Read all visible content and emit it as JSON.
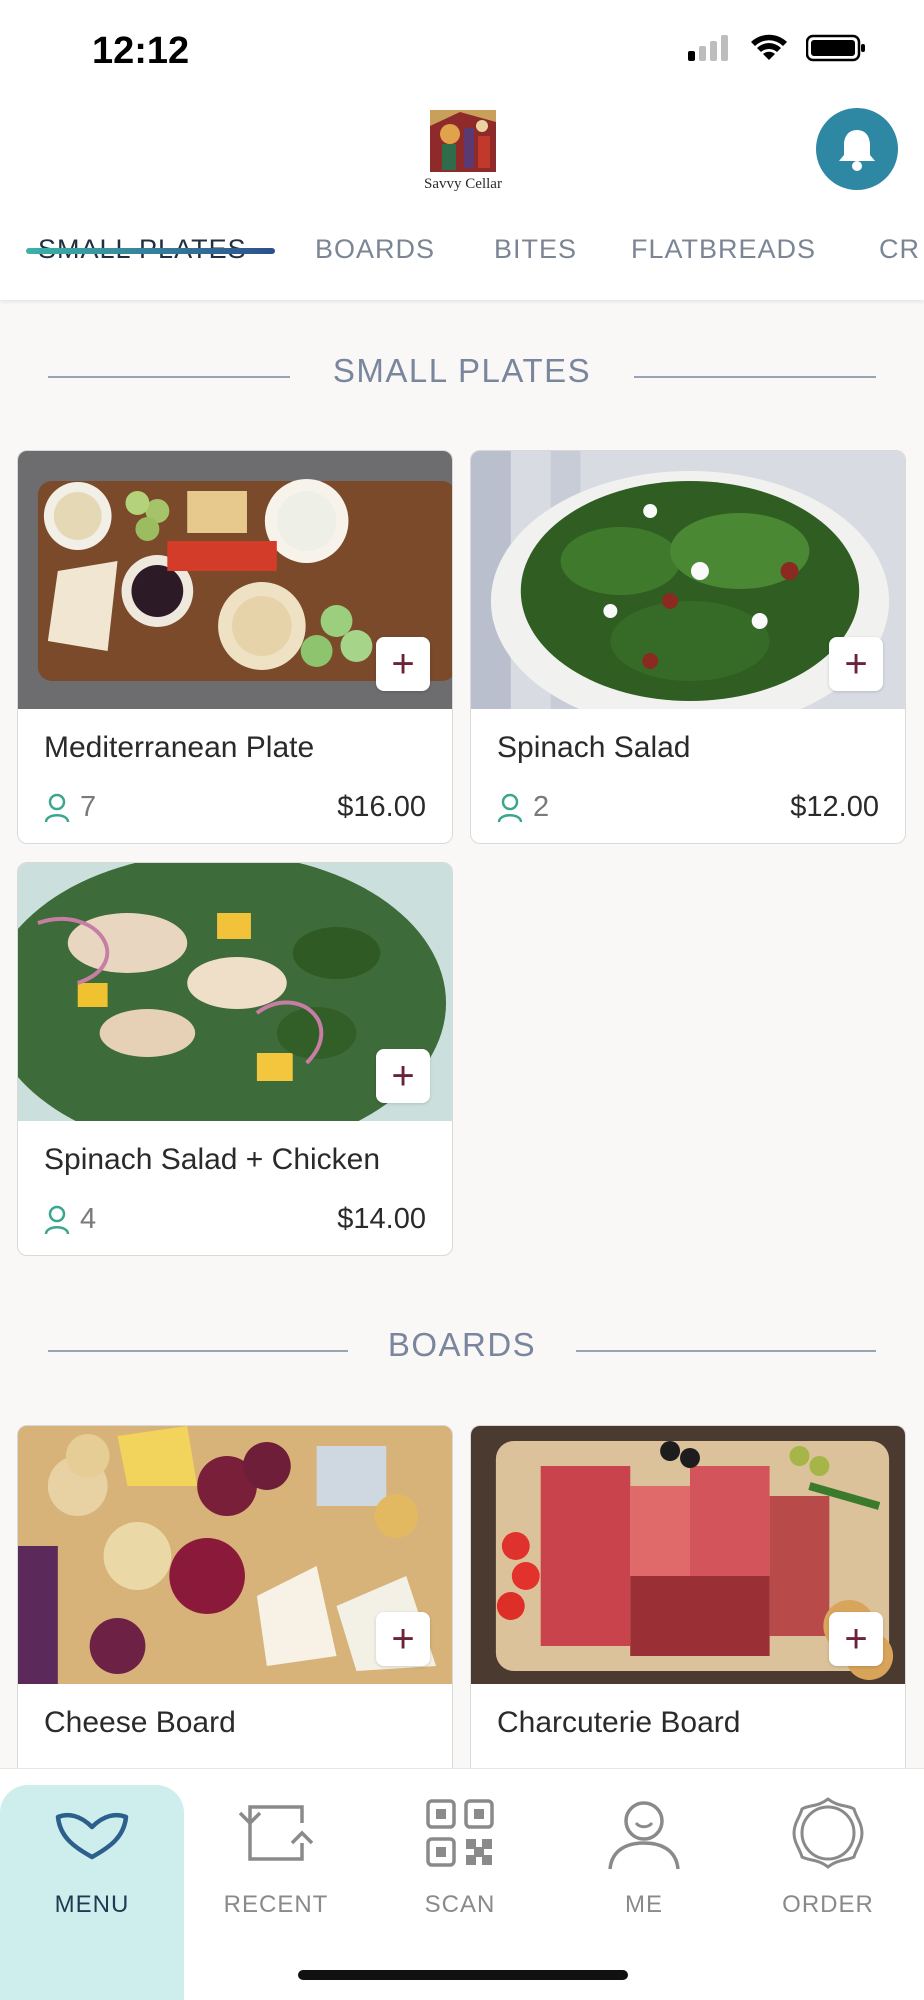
{
  "status_bar": {
    "time": "12:12"
  },
  "header": {
    "logo_text": "Savvy Cellar"
  },
  "tabs": [
    {
      "label": "SMALL PLATES",
      "active": true
    },
    {
      "label": "BOARDS",
      "active": false
    },
    {
      "label": "BITES",
      "active": false
    },
    {
      "label": "FLATBREADS",
      "active": false
    },
    {
      "label": "CR",
      "active": false
    }
  ],
  "sections": [
    {
      "title": "SMALL PLATES",
      "items": [
        {
          "name": "Mediterranean Plate",
          "count": "7",
          "price": "$16.00"
        },
        {
          "name": "Spinach Salad",
          "count": "2",
          "price": "$12.00"
        },
        {
          "name": "Spinach Salad + Chicken",
          "count": "4",
          "price": "$14.00"
        }
      ]
    },
    {
      "title": "BOARDS",
      "items": [
        {
          "name": "Cheese Board"
        },
        {
          "name": "Charcuterie Board"
        }
      ]
    }
  ],
  "add_label": "+",
  "bottom_nav": [
    {
      "label": "MENU",
      "icon": "menu-heart-icon",
      "active": true
    },
    {
      "label": "RECENT",
      "icon": "recent-icon",
      "active": false
    },
    {
      "label": "SCAN",
      "icon": "qr-scan-icon",
      "active": false
    },
    {
      "label": "ME",
      "icon": "profile-icon",
      "active": false
    },
    {
      "label": "ORDER",
      "icon": "order-icon",
      "active": false
    }
  ],
  "colors": {
    "accent": "#2f88a3",
    "add_plus": "#6a2338",
    "active_nav": "#cdeeed",
    "count_icon": "#3aa68e"
  }
}
